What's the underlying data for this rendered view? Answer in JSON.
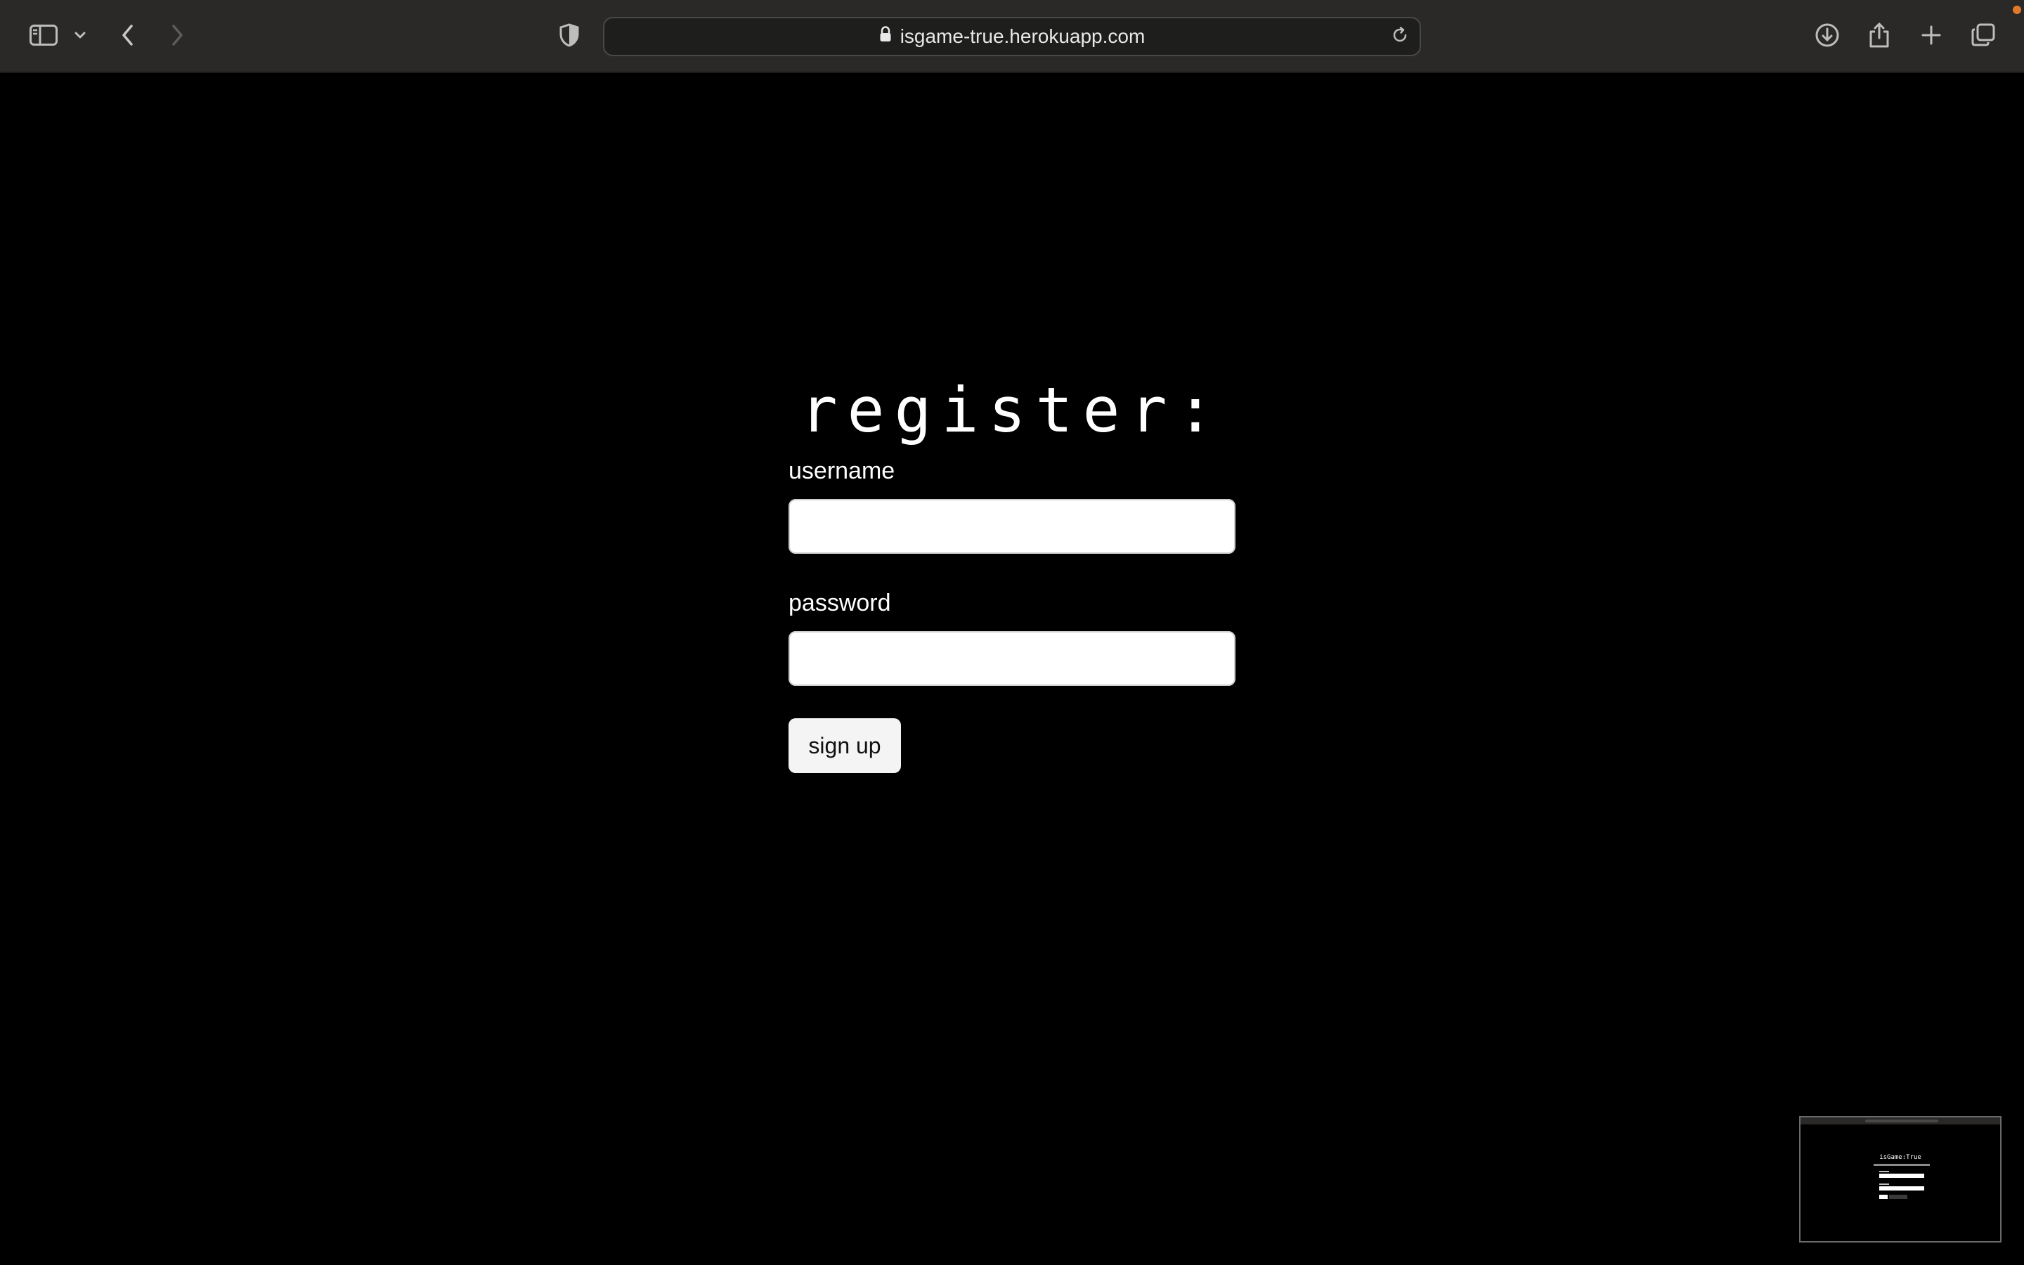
{
  "browser": {
    "url": "isgame-true.herokuapp.com",
    "accent_dot_color": "#e0792b",
    "icons": {
      "sidebar": "sidebar-icon",
      "tab_menu": "chevron-down-icon",
      "back": "chevron-left-icon",
      "forward": "chevron-right-icon",
      "privacy": "shield-icon",
      "lock": "lock-icon",
      "reload": "reload-icon",
      "downloads": "download-icon",
      "share": "share-icon",
      "new_tab": "plus-icon",
      "tab_overview": "tabs-icon"
    }
  },
  "page": {
    "background": "#000000",
    "title": "register:",
    "username_label": "username",
    "username_value": "",
    "password_label": "password",
    "password_value": "",
    "submit_label": "sign up"
  },
  "thumbnail": {
    "title": "isGame:True"
  }
}
